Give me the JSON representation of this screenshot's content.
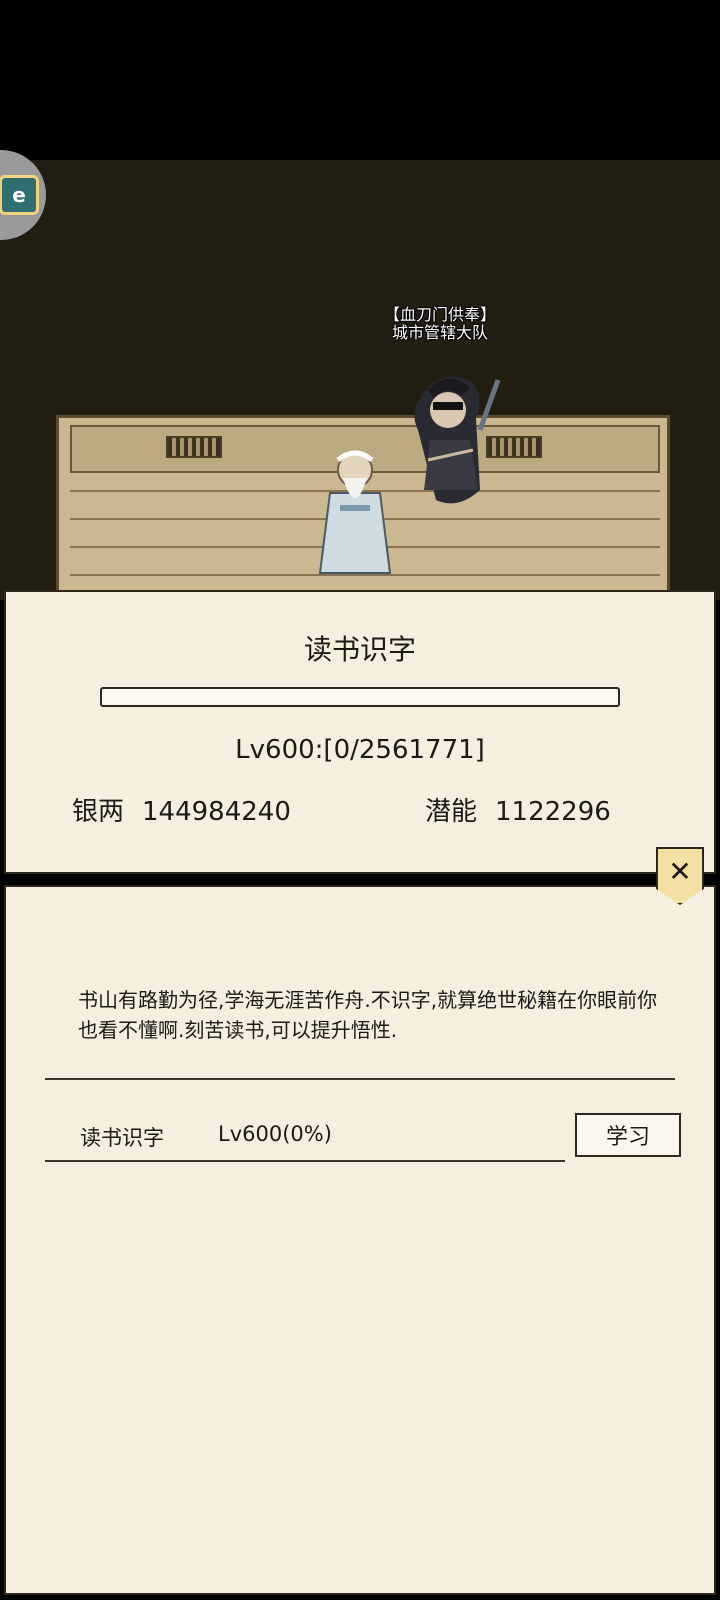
{
  "scene": {
    "npc_tag_line1": "【血刀门供奉】",
    "npc_tag_line2": "城市管辖大队"
  },
  "floating_button": {
    "icon": "app-shortcut-icon",
    "glyph": "e"
  },
  "skill_panel": {
    "title": "读书识字",
    "progress_fraction": 0,
    "level_text": "Lv600:[0/2561771]",
    "silver_label": "银两",
    "silver_value": "144984240",
    "potential_label": "潜能",
    "potential_value": "1122296"
  },
  "close_button": {
    "icon": "close-icon",
    "glyph": "✕"
  },
  "detail_panel": {
    "description": "书山有路勤为径,学海无涯苦作舟.不识字,就算绝世秘籍在你眼前你也看不懂啊.刻苦读书,可以提升悟性.",
    "skill_row": {
      "name": "读书识字",
      "level": "Lv600(0%)",
      "learn_label": "学习"
    }
  },
  "colors": {
    "panel_bg": "#f6efdf",
    "border": "#2c261d",
    "close_bg": "#f4dfa4",
    "scene_bg": "#231e12"
  }
}
